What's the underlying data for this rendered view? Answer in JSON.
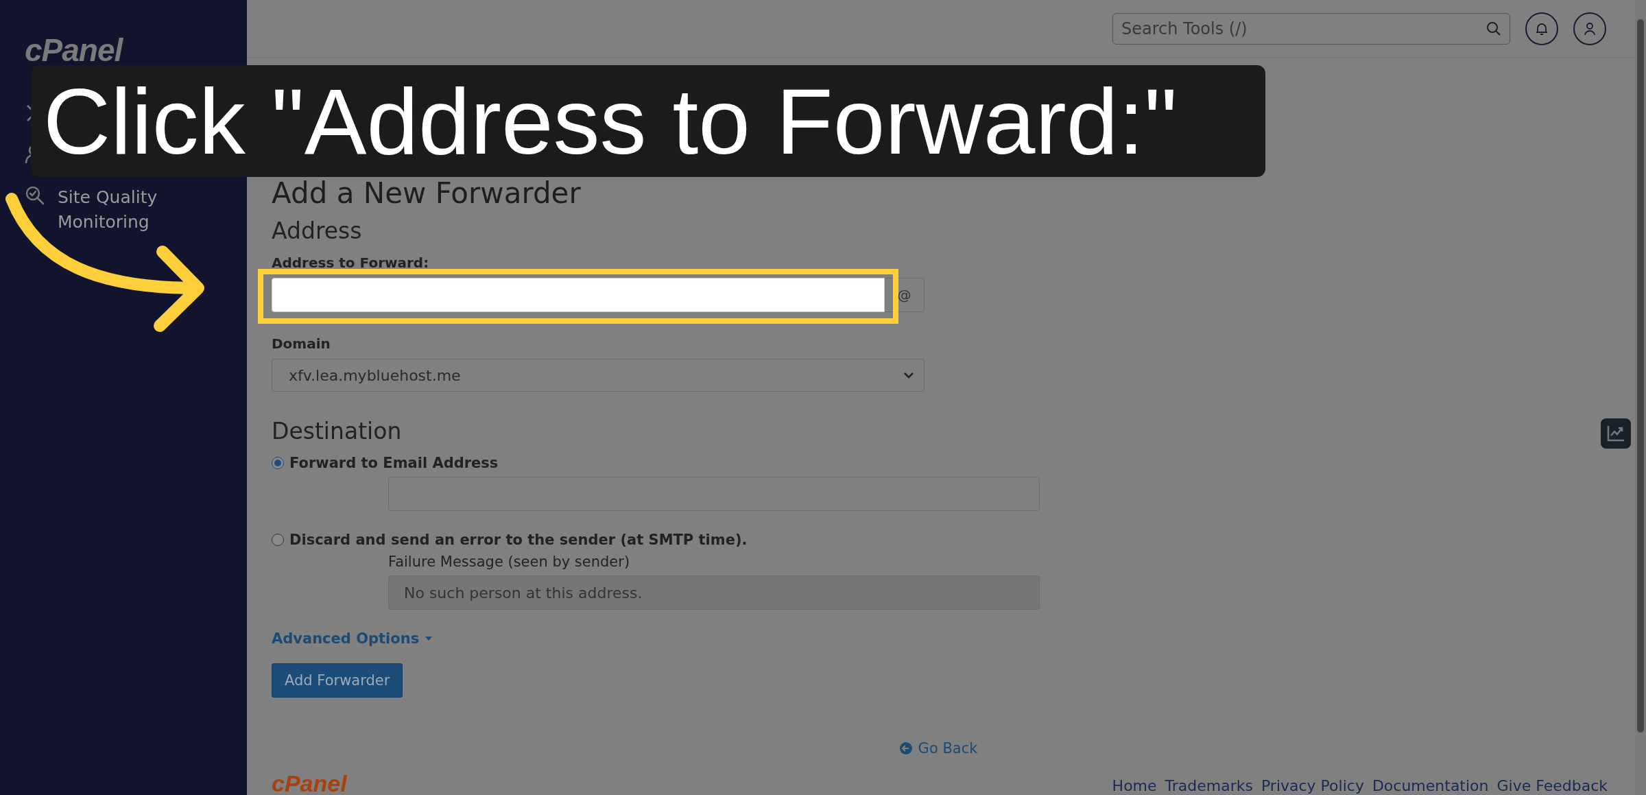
{
  "sidebar": {
    "logo": "cPanel",
    "items": [
      {
        "kind": "tools"
      },
      {
        "kind": "team"
      },
      {
        "kind": "quality",
        "label": "Site Quality Monitoring"
      }
    ]
  },
  "header": {
    "search": {
      "placeholder": "Search Tools (/)"
    }
  },
  "page": {
    "subtitle": "Add a New Forwarder",
    "address_section": "Address",
    "address_label": "Address to Forward:",
    "address_addon": "@",
    "domain_label": "Domain",
    "domain_value": "xfv.lea.mybluehost.me",
    "destination_title": "Destination",
    "options": [
      {
        "kind": "email",
        "label": "Forward to Email Address",
        "selected": true
      },
      {
        "kind": "failure",
        "label": "Discard and send an error to the sender (at SMTP time).",
        "selected": false,
        "field_label": "Failure Message (seen by sender)",
        "value": "No such person at this address."
      }
    ],
    "advanced": "Advanced Options",
    "submit": "Add Forwarder",
    "back": "Go Back"
  },
  "footer": {
    "logo": "cPanel",
    "links": [
      "Home",
      "Trademarks",
      "Privacy Policy",
      "Documentation",
      "Give Feedback"
    ]
  },
  "tutorial": {
    "caption": "Click \"Address to Forward:\""
  }
}
